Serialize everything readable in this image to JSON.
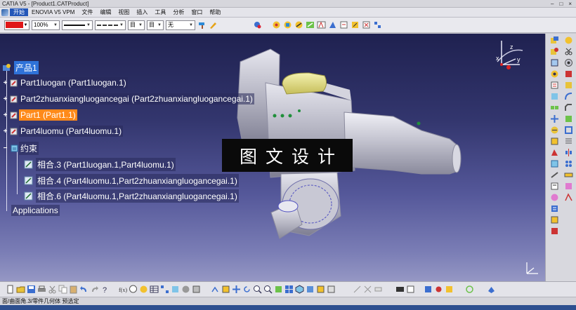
{
  "window": {
    "title": "CATIA V5 - [Product1.CATProduct]",
    "controls": [
      "–",
      "□",
      "×"
    ]
  },
  "menu": {
    "items": [
      "开始",
      "ENOVIA V5 VPM",
      "文件",
      "编辑",
      "视图",
      "插入",
      "工具",
      "分析",
      "窗口",
      "帮助"
    ],
    "active_index": 0
  },
  "format_toolbar": {
    "color": "#e01818",
    "transparency": "100%",
    "layer": "无"
  },
  "tree": {
    "root": "产品1",
    "parts": [
      "Part1luogan (Part1luogan.1)",
      "Part2zhuanxiangluogancegai (Part2zhuanxiangluogancegai.1)",
      "Part1 (Part1.1)",
      "Part4luomu (Part4luomu.1)"
    ],
    "constraints_label": "约束",
    "constraints": [
      "相合.3 (Part1luogan.1,Part4luomu.1)",
      "相合.4 (Part4luomu.1,Part2zhuanxiangluogancegai.1)",
      "相合.6 (Part4luomu.1,Part2zhuanxiangluogancegai.1)"
    ],
    "applications": "Applications"
  },
  "watermark": "图文设计",
  "compass": {
    "axes": [
      "x",
      "y",
      "z"
    ]
  },
  "statusbar": {
    "text": "面/曲面角.3/零件几何体 预选定"
  }
}
